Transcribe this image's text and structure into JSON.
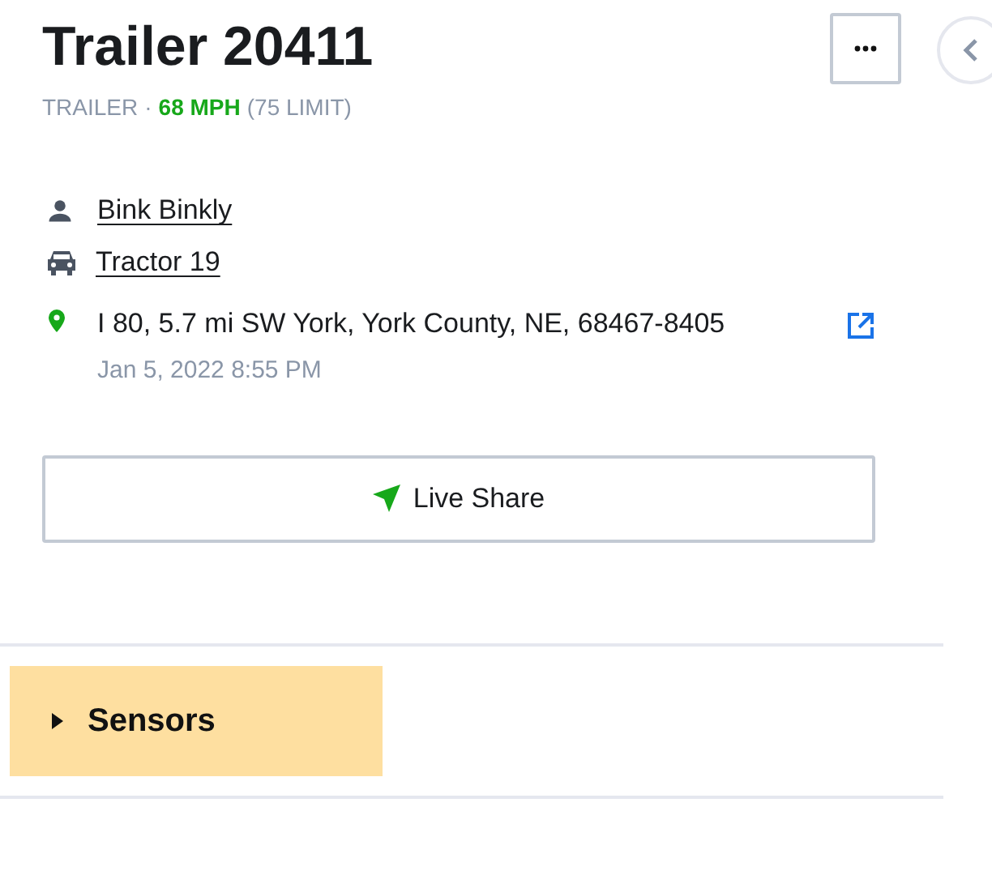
{
  "title": "Trailer 20411",
  "subtitle": {
    "type": "TRAILER",
    "separator": "·",
    "speed": "68 MPH",
    "limit": "(75 LIMIT)"
  },
  "driver": "Bink Binkly",
  "vehicle": "Tractor 19",
  "location": {
    "address": "I 80, 5.7 mi SW York, York County, NE, 68467-8405",
    "time": "Jan 5, 2022 8:55 PM"
  },
  "live_share": "Live Share",
  "sections": [
    {
      "label": "Sensors",
      "expanded": false
    }
  ]
}
